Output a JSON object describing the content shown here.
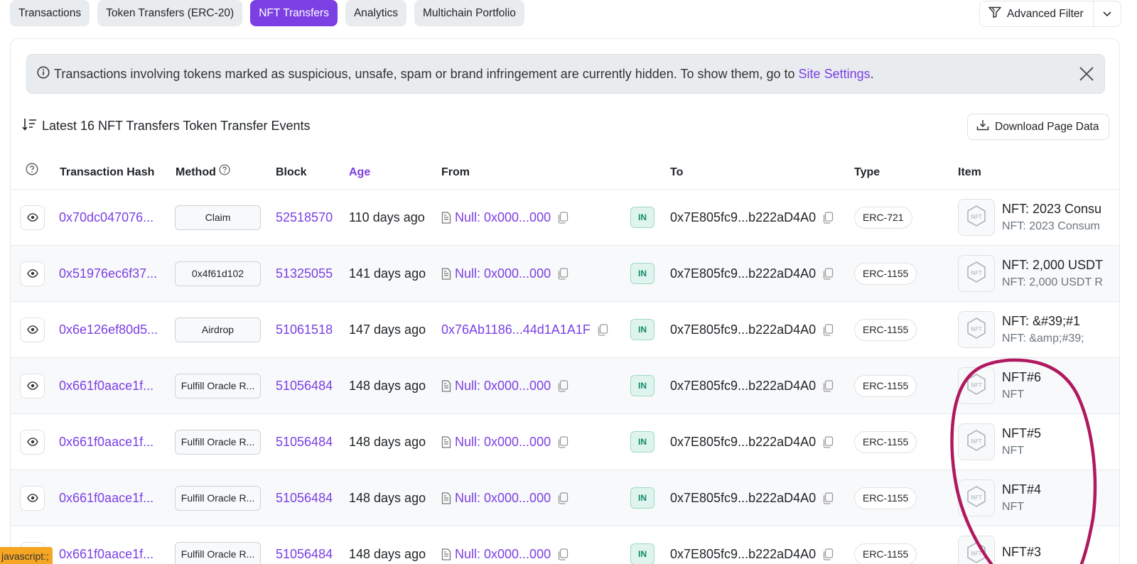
{
  "tabs": [
    {
      "label": "Transactions",
      "active": false
    },
    {
      "label": "Token Transfers (ERC-20)",
      "active": false
    },
    {
      "label": "NFT Transfers",
      "active": true
    },
    {
      "label": "Analytics",
      "active": false
    },
    {
      "label": "Multichain Portfolio",
      "active": false
    }
  ],
  "filter": {
    "label": "Advanced Filter"
  },
  "alert": {
    "text": "Transactions involving tokens marked as suspicious, unsafe, spam or brand infringement are currently hidden. To show them, go to ",
    "link": "Site Settings",
    "suffix": "."
  },
  "heading": "Latest 16 NFT Transfers Token Transfer Events",
  "download": {
    "label": "Download Page Data"
  },
  "columns": {
    "tx_hash": "Transaction Hash",
    "method": "Method",
    "block": "Block",
    "age": "Age",
    "from": "From",
    "to": "To",
    "type": "Type",
    "item": "Item"
  },
  "rows": [
    {
      "hash": "0x70dc047076...",
      "method": "Claim",
      "block": "52518570",
      "age": "110 days ago",
      "from": "Null: 0x000...000",
      "from_is_null": true,
      "direction": "IN",
      "to": "0x7E805fc9...b222aD4A0",
      "type": "ERC-721",
      "item_name": "NFT: 2023 Consu",
      "item_sub": "NFT: 2023 Consum"
    },
    {
      "hash": "0x51976ec6f37...",
      "method": "0x4f61d102",
      "block": "51325055",
      "age": "141 days ago",
      "from": "Null: 0x000...000",
      "from_is_null": true,
      "direction": "IN",
      "to": "0x7E805fc9...b222aD4A0",
      "type": "ERC-1155",
      "item_name": "NFT: 2,000 USDT",
      "item_sub": "NFT: 2,000 USDT R"
    },
    {
      "hash": "0x6e126ef80d5...",
      "method": "Airdrop",
      "block": "51061518",
      "age": "147 days ago",
      "from": "0x76Ab1186...44d1A1A1F",
      "from_is_null": false,
      "direction": "IN",
      "to": "0x7E805fc9...b222aD4A0",
      "type": "ERC-1155",
      "item_name": "NFT: &#39;#1",
      "item_sub": "NFT: &amp;#39;"
    },
    {
      "hash": "0x661f0aace1f...",
      "method": "Fulfill Oracle R...",
      "block": "51056484",
      "age": "148 days ago",
      "from": "Null: 0x000...000",
      "from_is_null": true,
      "direction": "IN",
      "to": "0x7E805fc9...b222aD4A0",
      "type": "ERC-1155",
      "item_name": "NFT#6",
      "item_sub": "NFT"
    },
    {
      "hash": "0x661f0aace1f...",
      "method": "Fulfill Oracle R...",
      "block": "51056484",
      "age": "148 days ago",
      "from": "Null: 0x000...000",
      "from_is_null": true,
      "direction": "IN",
      "to": "0x7E805fc9...b222aD4A0",
      "type": "ERC-1155",
      "item_name": "NFT#5",
      "item_sub": "NFT"
    },
    {
      "hash": "0x661f0aace1f...",
      "method": "Fulfill Oracle R...",
      "block": "51056484",
      "age": "148 days ago",
      "from": "Null: 0x000...000",
      "from_is_null": true,
      "direction": "IN",
      "to": "0x7E805fc9...b222aD4A0",
      "type": "ERC-1155",
      "item_name": "NFT#4",
      "item_sub": "NFT"
    },
    {
      "hash": "0x661f0aace1f...",
      "method": "Fulfill Oracle R...",
      "block": "51056484",
      "age": "148 days ago",
      "from": "Null: 0x000...000",
      "from_is_null": true,
      "direction": "IN",
      "to": "0x7E805fc9...b222aD4A0",
      "type": "ERC-1155",
      "item_name": "NFT#3",
      "item_sub": ""
    }
  ],
  "nft_icon_text": "NFT",
  "status_link": "javascript:;",
  "colors": {
    "accent": "#7b3fe4",
    "annotation": "#b0185f",
    "in_badge": "#0d8a6a"
  }
}
